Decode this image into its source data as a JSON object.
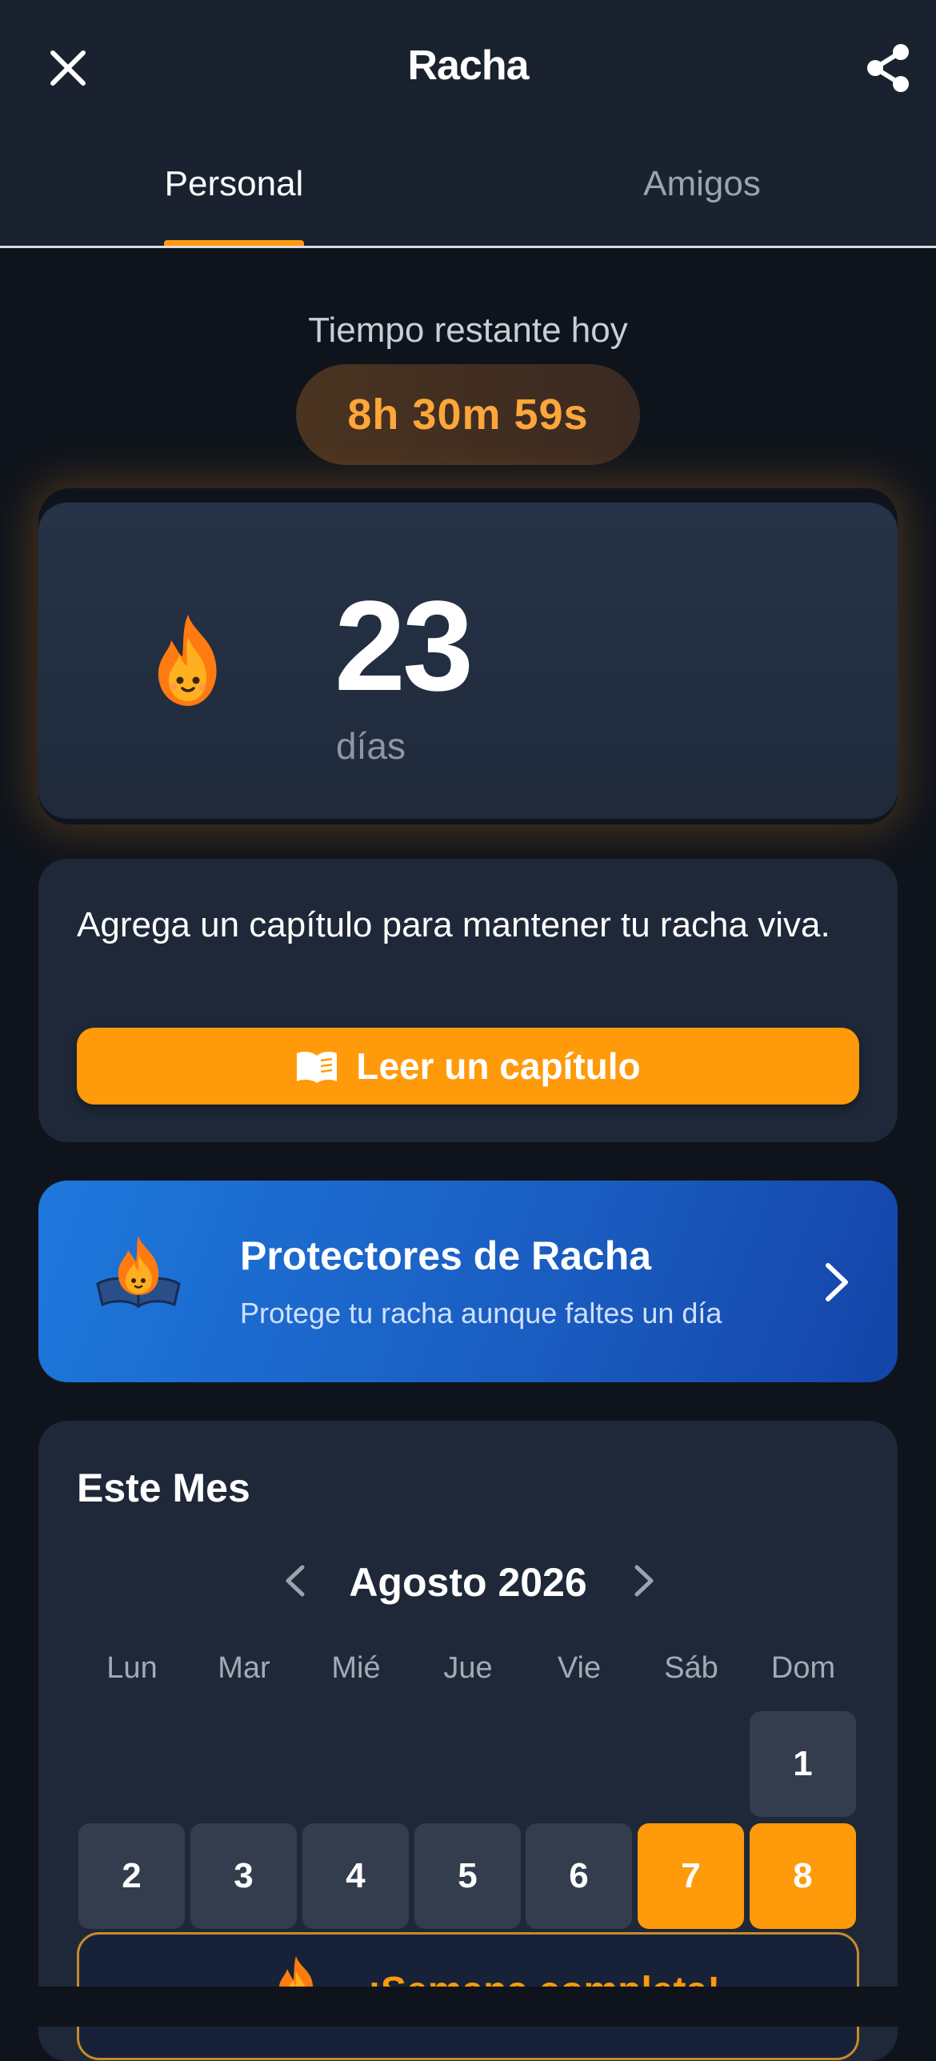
{
  "header": {
    "title": "Racha",
    "close_icon": "close-icon",
    "share_icon": "share-icon"
  },
  "tabs": [
    {
      "label": "Personal",
      "selected": true
    },
    {
      "label": "Amigos",
      "selected": false
    }
  ],
  "timer": {
    "label": "Tiempo restante hoy",
    "value": "8h 30m 59s"
  },
  "streak": {
    "icon": "flame-icon",
    "count": "23",
    "unit": "días"
  },
  "reminder": {
    "text": "Agrega un capítulo para mantener tu racha viva.",
    "button_label": "Leer un capítulo",
    "button_icon": "book-icon"
  },
  "protectors": {
    "title": "Protectores de Racha",
    "subtitle": "Protege tu racha aunque faltes un día",
    "icon": "flame-book-icon"
  },
  "calendar": {
    "section_title": "Este Mes",
    "month": "Agosto",
    "year": "2026",
    "weekdays": [
      "Lun",
      "Mar",
      "Mié",
      "Jue",
      "Vie",
      "Sáb",
      "Dom"
    ],
    "days": [
      {
        "day": "1",
        "streak": false
      },
      {
        "day": "2",
        "streak": false
      },
      {
        "day": "3",
        "streak": false
      },
      {
        "day": "4",
        "streak": false
      },
      {
        "day": "5",
        "streak": false
      },
      {
        "day": "6",
        "streak": false
      },
      {
        "day": "7",
        "streak": true
      },
      {
        "day": "8",
        "streak": true
      }
    ],
    "week_banner": "¡Semana completa!"
  },
  "colors": {
    "accent": "#ff9a0b",
    "background": "#0f141c",
    "card": "#1e2838",
    "protector_blue": "#1a5cc0"
  }
}
